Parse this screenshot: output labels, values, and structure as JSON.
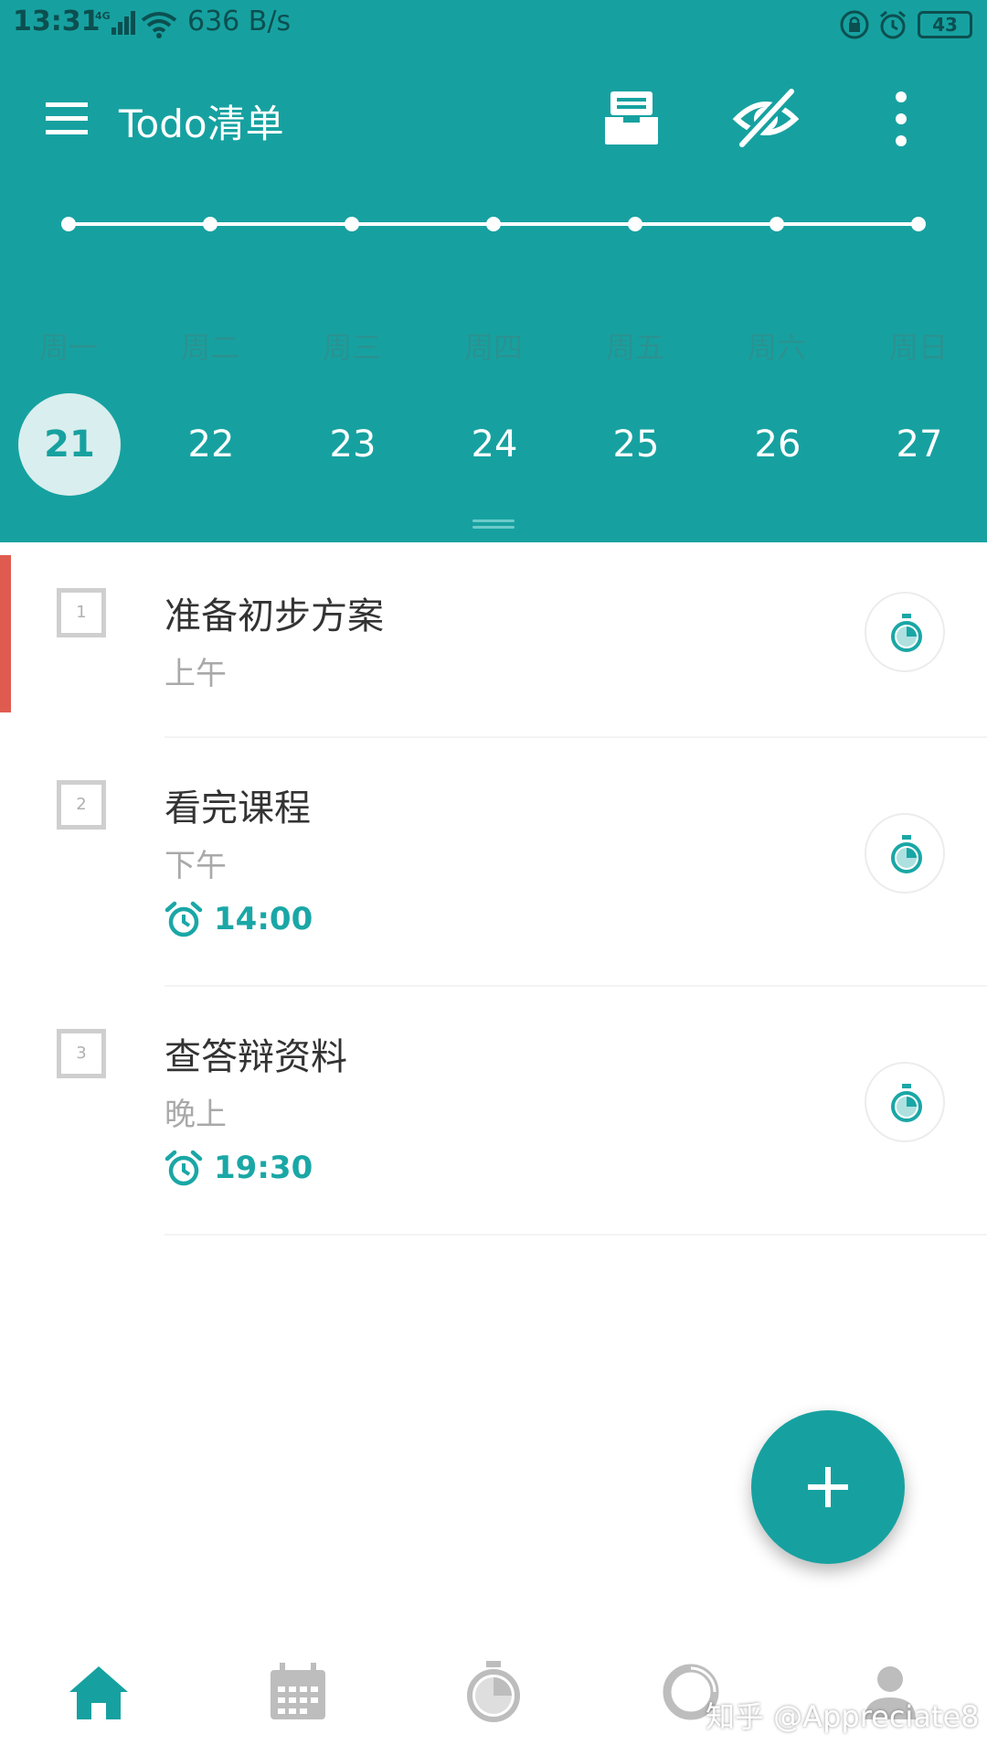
{
  "status_bar": {
    "time": "13:31",
    "network_type": "4G",
    "speed": "636 B/s",
    "battery": "43"
  },
  "toolbar": {
    "title": "Todo清单",
    "icons": [
      "menu-icon",
      "inbox-icon",
      "eye-off-icon",
      "more-vert-icon"
    ]
  },
  "week": {
    "days": [
      {
        "weekday": "周一",
        "date": "21",
        "selected": true
      },
      {
        "weekday": "周二",
        "date": "22",
        "selected": false
      },
      {
        "weekday": "周三",
        "date": "23",
        "selected": false
      },
      {
        "weekday": "周四",
        "date": "24",
        "selected": false
      },
      {
        "weekday": "周五",
        "date": "25",
        "selected": false
      },
      {
        "weekday": "周六",
        "date": "26",
        "selected": false
      },
      {
        "weekday": "周日",
        "date": "27",
        "selected": false
      }
    ]
  },
  "tasks": [
    {
      "index": "1",
      "title": "准备初步方案",
      "period": "上午",
      "reminder": "",
      "priority_color": "#e05b4f"
    },
    {
      "index": "2",
      "title": "看完课程",
      "period": "下午",
      "reminder": "14:00",
      "priority_color": ""
    },
    {
      "index": "3",
      "title": "查答辩资料",
      "period": "晚上",
      "reminder": "19:30",
      "priority_color": ""
    }
  ],
  "bottom_nav": {
    "items": [
      "home-icon",
      "calendar-icon",
      "timer-icon",
      "stats-icon",
      "profile-icon"
    ],
    "active": "home-icon"
  },
  "watermark": "知乎 @Appreciate8",
  "colors": {
    "primary": "#16a1a0",
    "accent_red": "#e05b4f",
    "nav_inactive": "#bdbdbd"
  }
}
